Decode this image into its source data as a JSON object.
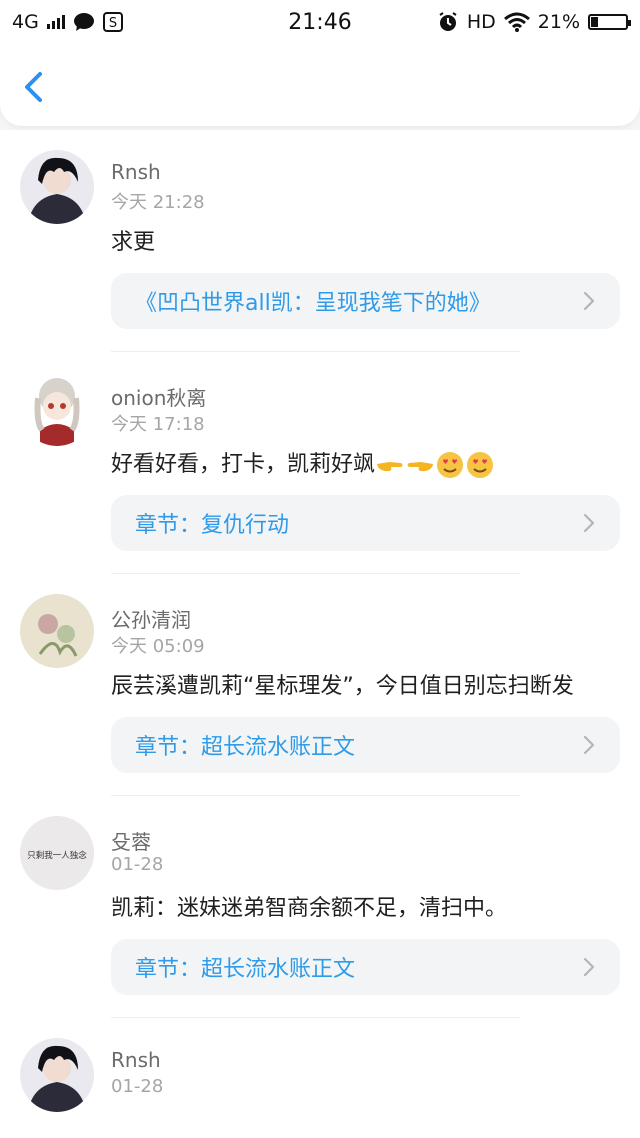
{
  "status_bar": {
    "network": "4G",
    "time": "21:46",
    "hd": "HD",
    "battery_text": "21%",
    "battery_level": 0.21
  },
  "nav": {
    "back_icon": "chevron-left-icon"
  },
  "comments": [
    {
      "user": "Rnsh",
      "time": "今天 21:28",
      "text": "求更",
      "ref": "《凹凸世界all凯：呈现我笔下的她》"
    },
    {
      "user": "onion秋离",
      "time": "今天 17:18",
      "text": "好看好看，打卡，凯莉好飒",
      "emojis": [
        "pointing-right-emoji",
        "pointing-left-emoji",
        "heart-eyes-emoji",
        "heart-eyes-emoji"
      ],
      "ref": "章节：复仇行动"
    },
    {
      "user": "公孙清润",
      "time": "今天 05:09",
      "text": "辰芸溪遭凯莉“星标理发”，今日值日别忘扫断发",
      "ref": "章节：超长流水账正文"
    },
    {
      "user": "殳蓉",
      "time": "01-28",
      "text": "凯莉：迷妹迷弟智商余额不足，清扫中。",
      "ref": "章节：超长流水账正文",
      "avatar_text": "只剩我一人独念"
    },
    {
      "user": "Rnsh",
      "time": "01-28"
    }
  ],
  "colors": {
    "link": "#2f9be8",
    "accent": "#2c8ff2"
  }
}
